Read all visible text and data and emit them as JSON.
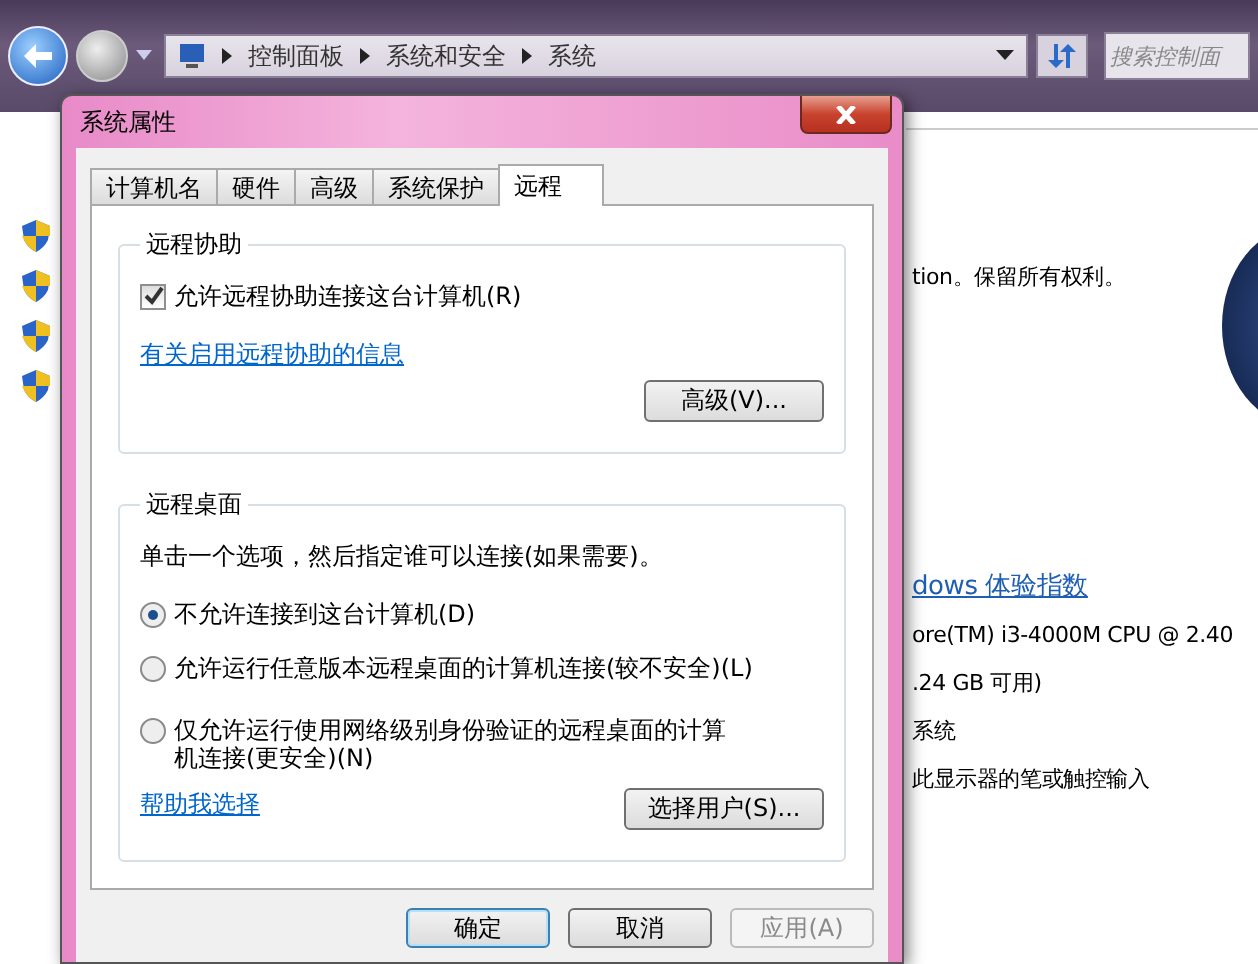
{
  "nav": {
    "breadcrumb": [
      "控制面板",
      "系统和安全",
      "系统"
    ],
    "search": {
      "placeholder": "搜索控制面"
    }
  },
  "background_texts": [
    {
      "text": "tion。保留所有权利。",
      "kind": "plain"
    },
    {
      "text": "dows 体验指数",
      "kind": "link"
    },
    {
      "text": "ore(TM) i3-4000M CPU @ 2.40",
      "kind": "plain"
    },
    {
      "text": ".24 GB 可用)",
      "kind": "plain"
    },
    {
      "text": "系统",
      "kind": "plain"
    },
    {
      "text": "此显示器的笔或触控输入",
      "kind": "plain"
    }
  ],
  "dialog": {
    "title": "系统属性",
    "tabs": [
      {
        "label": "计算机名",
        "selected": false
      },
      {
        "label": "硬件",
        "selected": false
      },
      {
        "label": "高级",
        "selected": false
      },
      {
        "label": "系统保护",
        "selected": false
      },
      {
        "label": "远程",
        "selected": true
      }
    ],
    "remote_assistance": {
      "title": "远程协助",
      "checkbox": {
        "label": "允许远程协助连接这台计算机(R)",
        "checked": true
      },
      "link": "有关启用远程协助的信息",
      "button": "高级(V)..."
    },
    "remote_desktop": {
      "title": "远程桌面",
      "instruction": "单击一个选项，然后指定谁可以连接(如果需要)。",
      "options": [
        {
          "label": "不允许连接到这台计算机(D)",
          "selected": true
        },
        {
          "label": "允许运行任意版本远程桌面的计算机连接(较不安全)(L)",
          "selected": false
        },
        {
          "label": "仅允许运行使用网络级别身份验证的远程桌面的计算机连接(更安全)(N)",
          "selected": false
        }
      ],
      "help_link": "帮助我选择",
      "button": "选择用户(S)..."
    },
    "buttons": [
      {
        "label": "确定",
        "disabled": false,
        "default": true
      },
      {
        "label": "取消",
        "disabled": false,
        "default": false
      },
      {
        "label": "应用(A)",
        "disabled": true,
        "default": false
      }
    ]
  }
}
